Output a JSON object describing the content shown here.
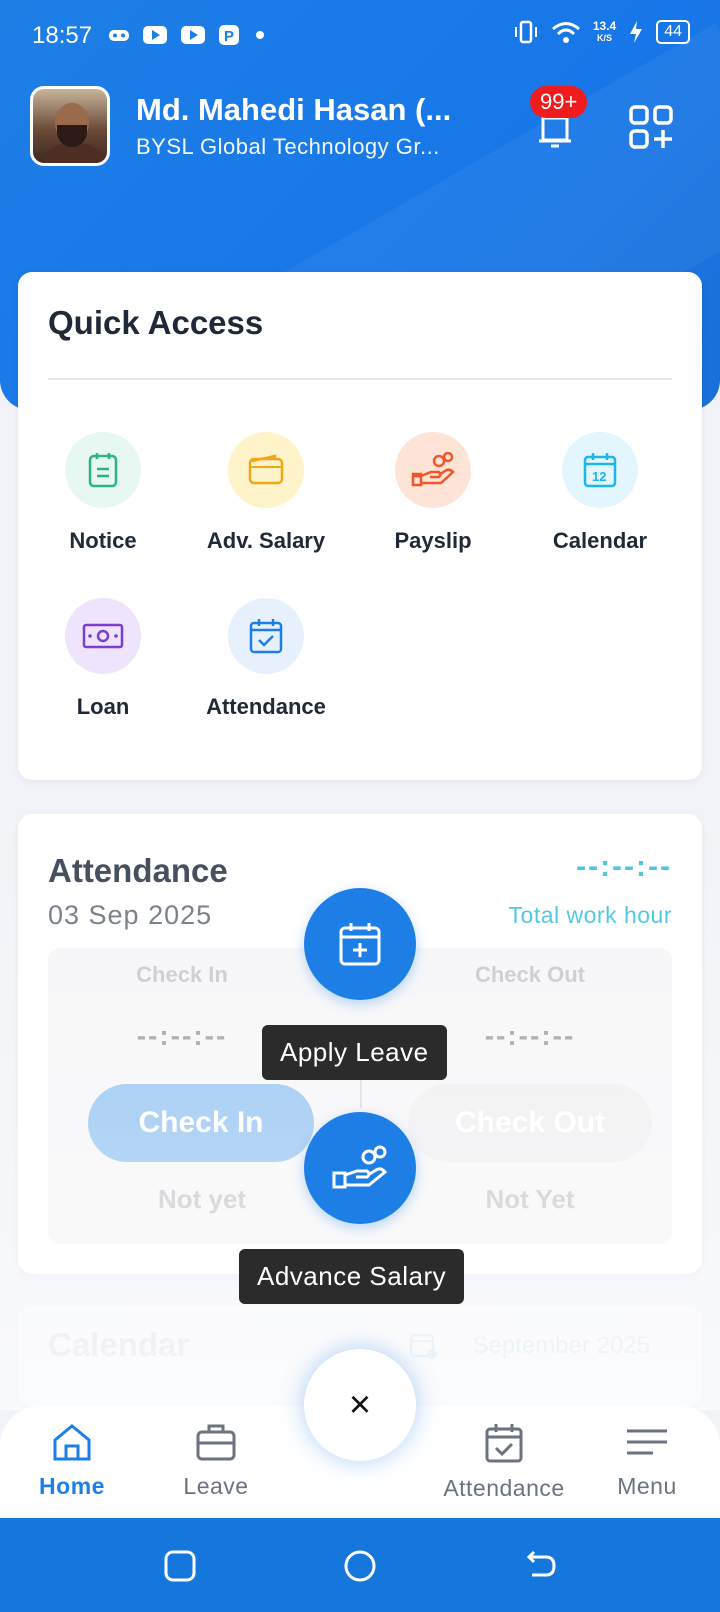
{
  "status_bar": {
    "time": "18:57",
    "network_speed_value": "13.4",
    "network_speed_unit": "K/S",
    "battery": "44"
  },
  "profile": {
    "name": "Md. Mahedi Hasan (...",
    "organization": "BYSL Global Technology Gr..."
  },
  "notifications": {
    "badge": "99+"
  },
  "quick_access": {
    "title": "Quick Access",
    "items": [
      {
        "label": "Notice",
        "icon": "notice-icon",
        "bg": "#e6f8f1",
        "color": "#2bb383"
      },
      {
        "label": "Adv. Salary",
        "icon": "wallet-icon",
        "bg": "#fff3c9",
        "color": "#f0a916"
      },
      {
        "label": "Payslip",
        "icon": "hand-coins-icon",
        "bg": "#fde4d6",
        "color": "#f0562a"
      },
      {
        "label": "Calendar",
        "icon": "calendar-12-icon",
        "bg": "#e3f5fd",
        "color": "#1ab7e8"
      },
      {
        "label": "Loan",
        "icon": "banknote-icon",
        "bg": "#eee4fb",
        "color": "#7a3fd1"
      },
      {
        "label": "Attendance",
        "icon": "calendar-check-icon",
        "bg": "#e6f1fd",
        "color": "#1d7fe6"
      }
    ]
  },
  "attendance": {
    "title": "Attendance",
    "date": "03 Sep 2025",
    "clock": "--:--:--",
    "total_label": "Total work hour",
    "check_in_label": "Check In",
    "check_out_label": "Check Out",
    "check_in_time": "--:--:--",
    "check_out_time": "--:--:--",
    "check_in_button": "Check In",
    "check_out_button": "Check Out",
    "check_in_status": "Not yet",
    "check_out_status": "Not Yet"
  },
  "calendar_card": {
    "title": "Calendar",
    "month": "September 2025"
  },
  "fab_menu": {
    "apply_leave": "Apply Leave",
    "advance_salary": "Advance Salary",
    "close": "×"
  },
  "bottom_nav": {
    "items": [
      {
        "label": "Home",
        "active": true
      },
      {
        "label": "Leave",
        "active": false
      },
      {
        "label": "Attendance",
        "active": false
      },
      {
        "label": "Menu",
        "active": false
      }
    ]
  },
  "colors": {
    "primary": "#1d7fe6",
    "accent_cyan": "#3ec2e0",
    "badge_red": "#ee1c1c"
  }
}
